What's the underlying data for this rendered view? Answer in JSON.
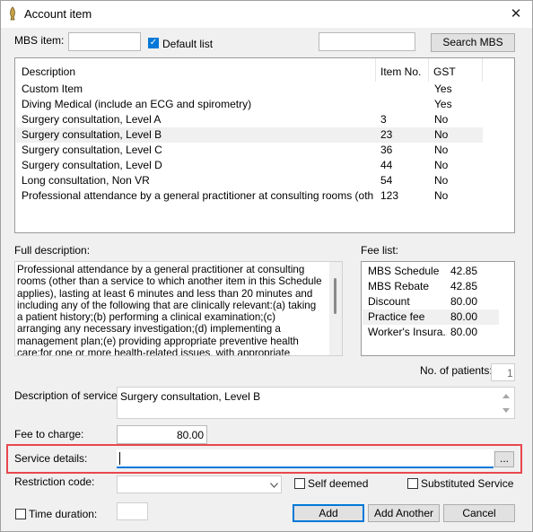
{
  "window": {
    "title": "Account item",
    "close_glyph": "✕"
  },
  "mbs": {
    "label": "MBS item:",
    "value": "",
    "search_value": "",
    "default_list_label": "Default list",
    "default_list_checked": true,
    "search_button": "Search MBS"
  },
  "items_table": {
    "columns": [
      "Description",
      "Item No.",
      "GST"
    ],
    "rows": [
      {
        "desc": "Custom Item",
        "no": "",
        "gst": "Yes"
      },
      {
        "desc": "Diving Medical (include an ECG and spirometry)",
        "no": "",
        "gst": "Yes"
      },
      {
        "desc": "Surgery consultation, Level A",
        "no": "3",
        "gst": "No"
      },
      {
        "desc": "Surgery consultation, Level B",
        "no": "23",
        "gst": "No"
      },
      {
        "desc": "Surgery consultation, Level C",
        "no": "36",
        "gst": "No"
      },
      {
        "desc": "Surgery consultation, Level D",
        "no": "44",
        "gst": "No"
      },
      {
        "desc": "Long consultation, Non VR",
        "no": "54",
        "gst": "No"
      },
      {
        "desc": "Professional attendance by a general practitioner at consulting rooms (other than ...",
        "no": "123",
        "gst": "No"
      }
    ]
  },
  "full_description": {
    "label": "Full description:",
    "text": "Professional attendance by a general practitioner at consulting rooms (other than a service to which another item in this Schedule applies), lasting at least 6 minutes and less than 20 minutes and including any of the following that are clinically relevant:(a) taking a patient history;(b) performing a clinical examination;(c) arranging any necessary investigation;(d) implementing a management plan;(e) providing appropriate preventive health care;for one or more health-related issues, with appropriate documentation."
  },
  "fee_list": {
    "label": "Fee list:",
    "rows": [
      {
        "name": "MBS Schedule",
        "value": "42.85"
      },
      {
        "name": "MBS Rebate",
        "value": "42.85"
      },
      {
        "name": "Discount",
        "value": "80.00"
      },
      {
        "name": "Practice fee",
        "value": "80.00"
      },
      {
        "name": "Worker's Insura...",
        "value": "80.00"
      }
    ]
  },
  "patients": {
    "label": "No. of patients:",
    "value": "1"
  },
  "service": {
    "label": "Description of service:",
    "value": "Surgery consultation, Level B"
  },
  "fee": {
    "label": "Fee to charge:",
    "value": "80.00"
  },
  "details": {
    "label": "Service details:",
    "value": "",
    "browse_button": "..."
  },
  "restriction": {
    "label": "Restriction code:",
    "value": "",
    "self_deemed_label": "Self deemed",
    "substituted_label": "Substituted Service"
  },
  "time": {
    "label": "Time duration:",
    "value": ""
  },
  "buttons": {
    "add": "Add",
    "add_another": "Add Another",
    "cancel": "Cancel"
  },
  "colors": {
    "accent": "#0078d7",
    "highlight": "#e8474d",
    "selected_row": "#f0f0f0"
  }
}
